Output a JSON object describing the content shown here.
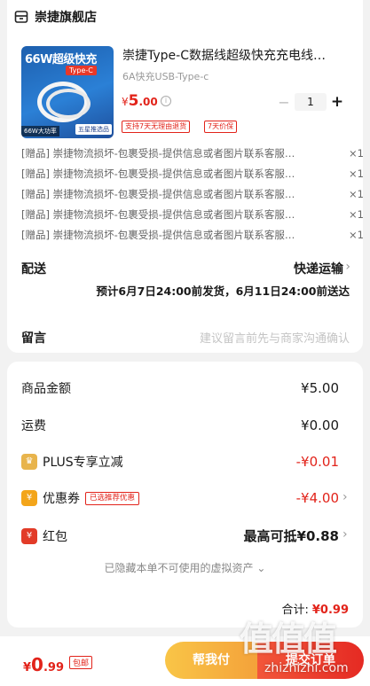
{
  "shop": {
    "name": "崇捷旗舰店"
  },
  "product": {
    "thumb_title": "66W超级快充",
    "thumb_sub": "Type-C",
    "thumb_badge_left": "66W大功率",
    "thumb_badge_right": "五星推选品",
    "title": "崇捷Type-C数据线超级快充充电线…",
    "spec": "6A快充USB-Type-c",
    "price_currency": "¥",
    "price_int": "5",
    "price_dec": ".00",
    "quantity": "1",
    "tags": [
      "支持7天无理由退货",
      "7天价保"
    ]
  },
  "gifts": [
    {
      "text": "[赠品] 崇捷物流损坏-包裹受损-提供信息或者图片联系客服…",
      "qty": "×1"
    },
    {
      "text": "[赠品] 崇捷物流损坏-包裹受损-提供信息或者图片联系客服…",
      "qty": "×1"
    },
    {
      "text": "[赠品] 崇捷物流损坏-包裹受损-提供信息或者图片联系客服…",
      "qty": "×1"
    },
    {
      "text": "[赠品] 崇捷物流损坏-包裹受损-提供信息或者图片联系客服…",
      "qty": "×1"
    },
    {
      "text": "[赠品] 崇捷物流损坏-包裹受损-提供信息或者图片联系客服…",
      "qty": "×1"
    }
  ],
  "shipping": {
    "label": "配送",
    "method": "快递运输",
    "estimate": "预计6月7日24:00前发货，6月11日24:00前送达"
  },
  "message": {
    "label": "留言",
    "placeholder": "建议留言前先与商家沟通确认"
  },
  "summary": {
    "goods_label": "商品金额",
    "goods_value": "¥5.00",
    "freight_label": "运费",
    "freight_value": "¥0.00",
    "plus_label": "PLUS专享立减",
    "plus_value": "-¥0.01",
    "coupon_label": "优惠券",
    "coupon_chip": "已选推荐优惠",
    "coupon_value": "-¥4.00",
    "hongbao_label": "红包",
    "hongbao_value": "最高可抵¥0.88",
    "hidden_assets": "已隐藏本单不可使用的虚拟资产",
    "total_label": "合计:",
    "total_value": "¥0.99"
  },
  "bottom_bar": {
    "price_currency": "¥",
    "price_int": "0",
    "price_dec": ".99",
    "tag": "包邮",
    "help_pay": "帮我付",
    "submit": "提交订单"
  },
  "watermark": {
    "main": "值值值",
    "sub": "zhizhizhi.com"
  },
  "colors": {
    "accent_red": "#e2231a",
    "help_pay_yellow": "#f4a23a",
    "background": "#f2f2f2"
  }
}
